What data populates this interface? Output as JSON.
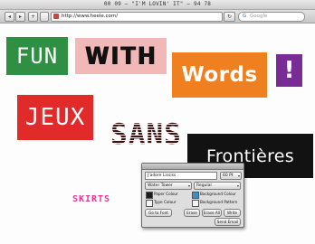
{
  "window": {
    "title": "00 09 – \"I'M LOVIN' IT\" – 94 78"
  },
  "toolbar": {
    "back_label": "◂",
    "forward_label": "▸",
    "add_label": "+",
    "url": "http://www.heeie.com/",
    "reload_label": "↻",
    "search_placeholder": "Google",
    "search_engine_glyph": "G"
  },
  "content": {
    "fun": "FUN",
    "with": "WITH",
    "words": "Words",
    "exclamation": "!",
    "jeux": "JEUX",
    "sans": "SANS",
    "frontieres": "Frontières",
    "skirts": "SKIRTS"
  },
  "colors": {
    "fun_bg": "#2f8f42",
    "with_bg": "#f2b7b7",
    "words_bg": "#f07f1f",
    "exclamation_bg": "#7a2c96",
    "jeux_bg": "#e12a2a",
    "frontieres_bg": "#121212",
    "skirts_text": "#e6379b"
  },
  "font_panel": {
    "text_input": "J'adore Lississ",
    "size_value": "60 Pt",
    "font_select": "Water Tower",
    "style_select": "Regular",
    "paper_colour_label": "Paper Colour",
    "background_colour_label": "Background Colour",
    "type_colour_label": "Type Colour",
    "background_pattern_label": "Background Pattern",
    "go_to_font_button": "Go to Font",
    "erase_button": "Erase",
    "erase_all_button": "Erase All",
    "write_button": "Write",
    "send_email_button": "Send Email",
    "paper_swatch_color": "#1c1c1c",
    "background_swatch_color": "#3c8ec7"
  }
}
